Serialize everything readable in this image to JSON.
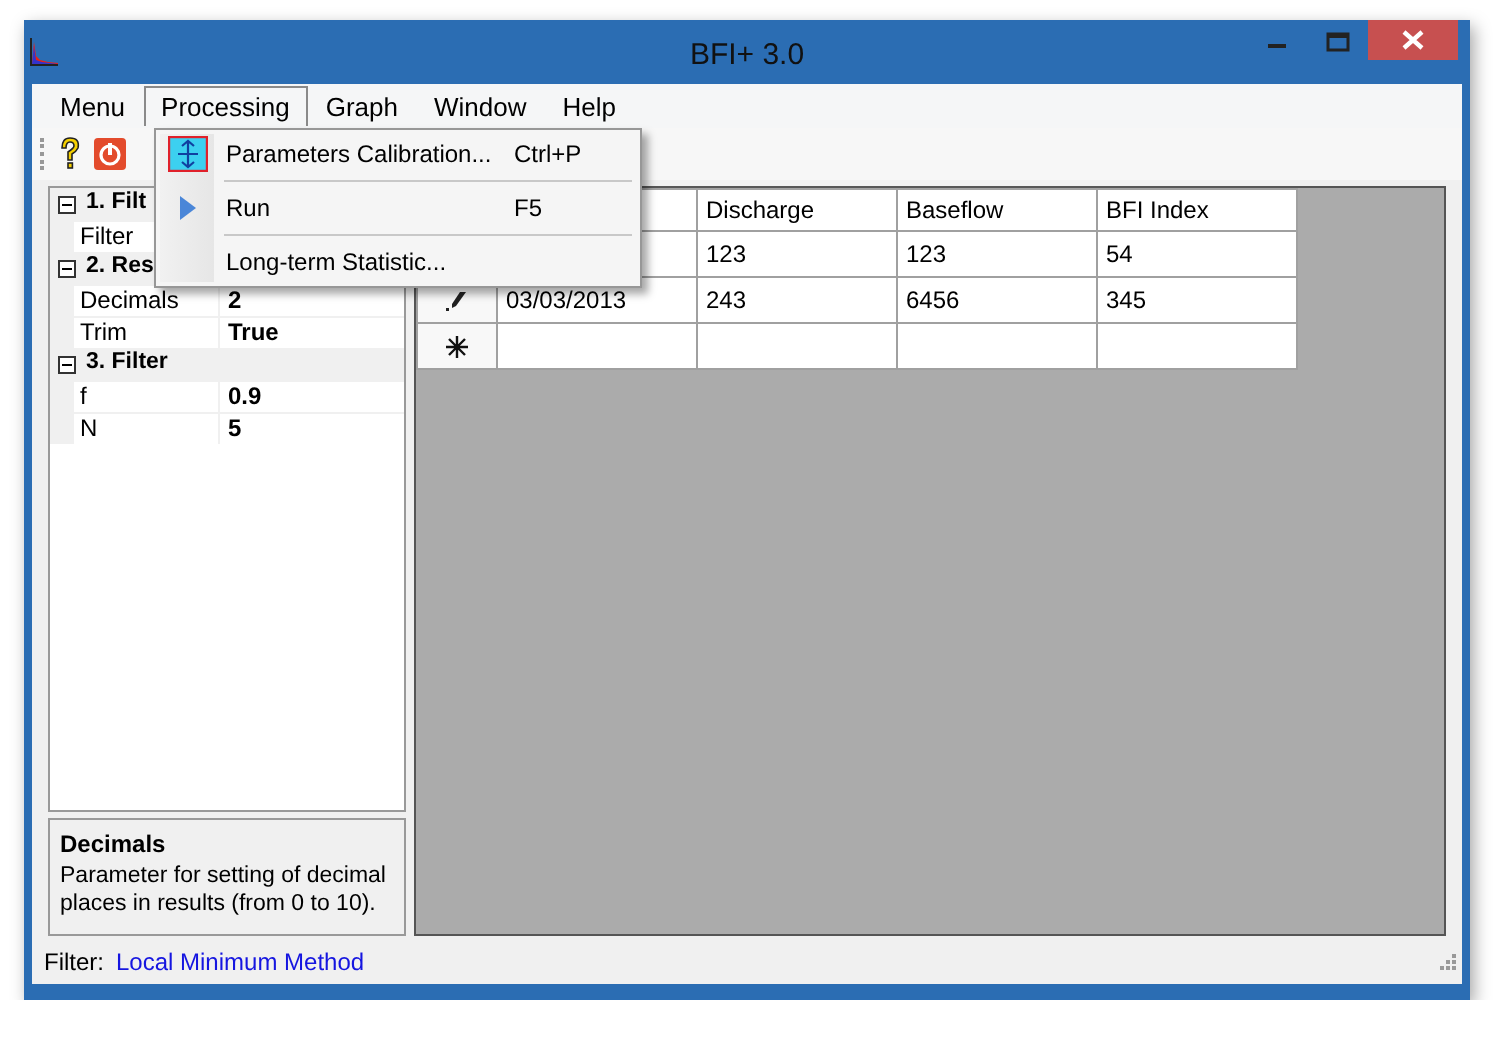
{
  "window": {
    "title": "BFI+ 3.0"
  },
  "menu_bar": [
    {
      "label": "Menu",
      "selected": false
    },
    {
      "label": "Processing",
      "selected": true
    },
    {
      "label": "Graph",
      "selected": false
    },
    {
      "label": "Window",
      "selected": false
    },
    {
      "label": "Help",
      "selected": false
    }
  ],
  "dropdown": [
    {
      "label": "Parameters Calibration...",
      "shortcut": "Ctrl+P",
      "kind": "calibrate"
    },
    {
      "label": "Run",
      "shortcut": "F5",
      "kind": "run"
    },
    {
      "label": "Long-term Statistic..."
    }
  ],
  "properties": [
    {
      "category": "1. Filt",
      "expanded": true,
      "items": [
        {
          "name": "Filter"
        }
      ]
    },
    {
      "category": "2. Res",
      "expanded": true,
      "items": [
        {
          "name": "Decimals",
          "value": "2"
        },
        {
          "name": "Trim",
          "value": "True"
        }
      ]
    },
    {
      "category": "3. Filter",
      "expanded": true,
      "items": [
        {
          "name": "f",
          "value": "0.9"
        },
        {
          "name": "N",
          "value": "5"
        }
      ]
    }
  ],
  "description": {
    "title": "Decimals",
    "text": "Parameter for setting of decimal places in results (from 0 to 10)."
  },
  "table": {
    "columns": [
      "Discharge",
      "Baseflow",
      "BFI Index"
    ],
    "rows": [
      {
        "cells": [
          "123",
          "123",
          "54"
        ]
      },
      {
        "kind": "edit",
        "date": "03/03/2013",
        "cells": [
          "243",
          "6456",
          "345"
        ]
      },
      {
        "kind": "new"
      }
    ]
  },
  "status_bar": {
    "label": "Filter:",
    "value": "Local Minimum Method"
  }
}
